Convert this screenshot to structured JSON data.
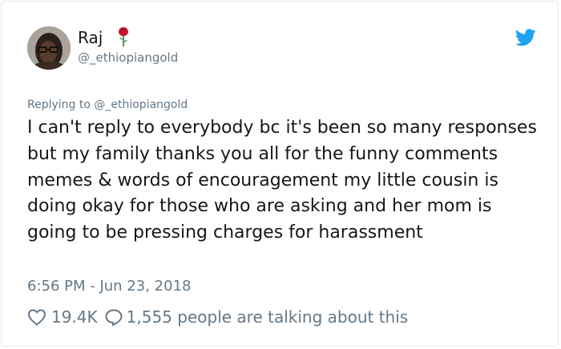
{
  "user": {
    "name": "Raj",
    "handle": "@_ethiopiangold",
    "emoji_icon": "rose-icon"
  },
  "header": {
    "brand_icon": "twitter-bird-icon",
    "brand_color": "#1da1f2"
  },
  "tweet": {
    "replying_to": "Replying to @_ethiopiangold",
    "text": "I can't reply to everybody bc it's been so many responses but my family thanks you all for the funny comments memes & words of encouragement my little cousin is doing okay for those who are asking and her mom is going to be pressing charges for harassment",
    "timestamp": "6:56 PM - Jun 23, 2018"
  },
  "actions": {
    "likes": "19.4K",
    "talking": "1,555 people are talking about this"
  }
}
